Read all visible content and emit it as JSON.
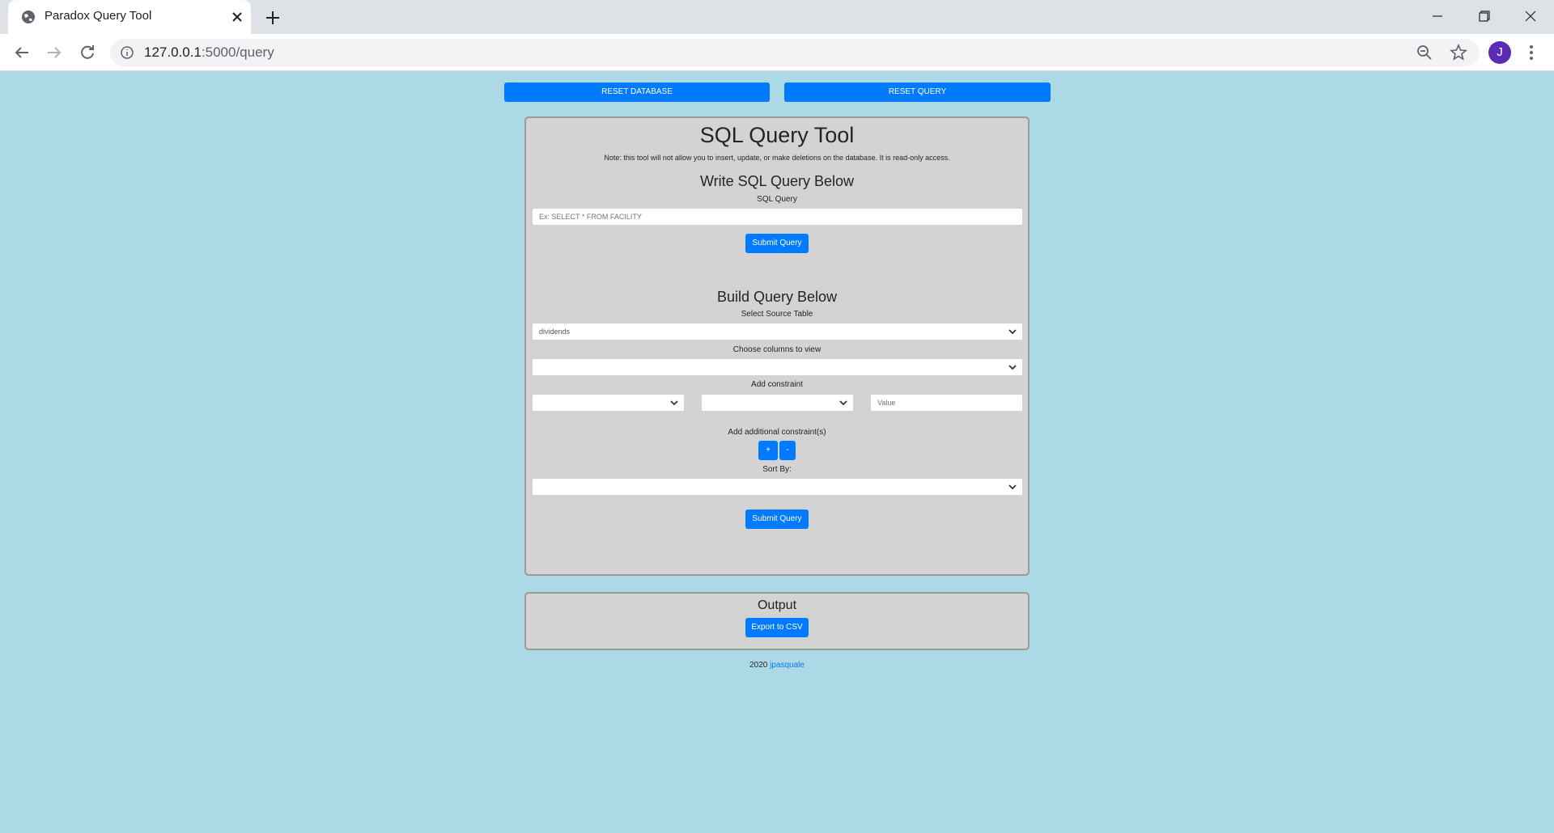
{
  "browser": {
    "tab_title": "Paradox Query Tool",
    "url_host": "127.0.0.1",
    "url_path": ":5000/query",
    "profile_initial": "J",
    "accent_color": "#5b2bb5"
  },
  "header_buttons": {
    "reset_database": "RESET DATABASE",
    "reset_query": "RESET QUERY"
  },
  "query_panel": {
    "title": "SQL Query Tool",
    "note": "Note: this tool will not allow you to insert, update, or make deletions on the database. It is read-only access.",
    "write_heading": "Write SQL Query Below",
    "sql_label": "SQL Query",
    "sql_placeholder": "Ex: SELECT * FROM FACILITY",
    "submit_label": "Submit Query",
    "build_heading": "Build Query Below",
    "source_table_label": "Select Source Table",
    "source_table_value": "dividends",
    "columns_label": "Choose columns to view",
    "constraint_label": "Add constraint",
    "value_placeholder": "Value",
    "additional_label": "Add additional constraint(s)",
    "add_btn": "+",
    "remove_btn": "-",
    "sort_label": "Sort By:",
    "submit_label_2": "Submit Query"
  },
  "output_panel": {
    "title": "Output",
    "export_label": "Export to CSV"
  },
  "footer": {
    "year": "2020",
    "author": "jpasquale"
  },
  "colors": {
    "page_bg": "#add8e6",
    "panel_bg": "#d3d3d3",
    "primary": "#007bff"
  }
}
